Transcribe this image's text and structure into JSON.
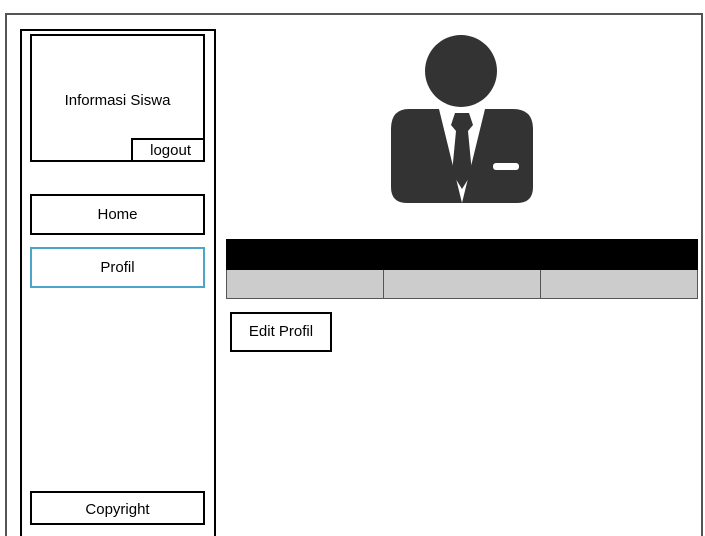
{
  "sidebar": {
    "title": "Informasi Siswa",
    "logout_label": "logout",
    "nav": {
      "home_label": "Home",
      "profil_label": "Profil"
    },
    "footer_label": "Copyright"
  },
  "main": {
    "avatar_icon": "user-business-icon",
    "table": {
      "headers": [
        "",
        "",
        ""
      ],
      "rows": [
        [
          "",
          "",
          ""
        ]
      ]
    },
    "edit_label": "Edit Profil"
  },
  "colors": {
    "active_nav_border": "#4aa6c8",
    "table_header_bg": "#000000",
    "table_cell_bg": "#cccccc",
    "avatar_fill": "#333333"
  }
}
